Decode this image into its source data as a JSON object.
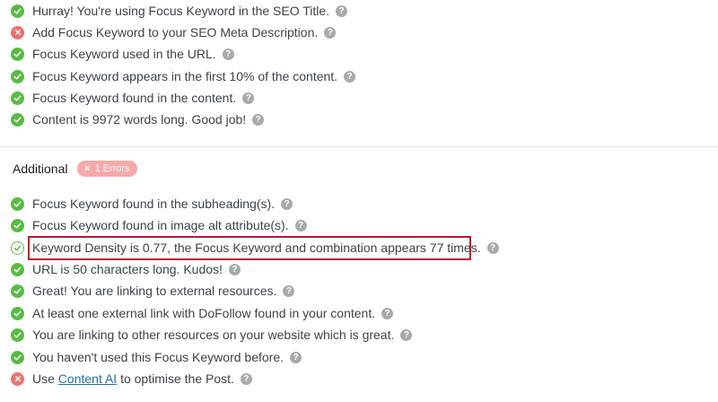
{
  "basic_checks": [
    {
      "status": "ok",
      "icon": "check-circle-icon",
      "text": "Hurray! You're using Focus Keyword in the SEO Title."
    },
    {
      "status": "fail",
      "icon": "error-circle-icon",
      "text": "Add Focus Keyword to your SEO Meta Description."
    },
    {
      "status": "ok",
      "icon": "check-circle-icon",
      "text": "Focus Keyword used in the URL."
    },
    {
      "status": "ok",
      "icon": "check-circle-icon",
      "text": "Focus Keyword appears in the first 10% of the content."
    },
    {
      "status": "ok",
      "icon": "check-circle-icon",
      "text": "Focus Keyword found in the content."
    },
    {
      "status": "ok",
      "icon": "check-circle-icon",
      "text": "Content is 9972 words long. Good job!"
    }
  ],
  "additional": {
    "title": "Additional",
    "error_badge": {
      "x": "×",
      "label": "1 Errors"
    },
    "checks": [
      {
        "status": "ok",
        "icon": "check-circle-icon",
        "text": "Focus Keyword found in the subheading(s)."
      },
      {
        "status": "ok",
        "icon": "check-circle-icon",
        "text": "Focus Keyword found in image alt attribute(s)."
      },
      {
        "status": "outline",
        "icon": "check-outline-icon",
        "text": "Keyword Density is 0.77, the Focus Keyword and combination appears 77 times.",
        "highlighted": true
      },
      {
        "status": "ok",
        "icon": "check-circle-icon",
        "text": "URL is 50 characters long. Kudos!"
      },
      {
        "status": "ok",
        "icon": "check-circle-icon",
        "text": "Great! You are linking to external resources."
      },
      {
        "status": "ok",
        "icon": "check-circle-icon",
        "text": "At least one external link with DoFollow found in your content."
      },
      {
        "status": "ok",
        "icon": "check-circle-icon",
        "text": "You are linking to other resources on your website which is great."
      },
      {
        "status": "ok",
        "icon": "check-circle-icon",
        "text": "You haven't used this Focus Keyword before."
      },
      {
        "status": "fail",
        "icon": "error-circle-icon",
        "text_before": "Use ",
        "link": "Content AI",
        "text_after": " to optimise the Post."
      }
    ]
  },
  "help_glyph": "?",
  "colors": {
    "ok": "#58bb43",
    "fail": "#ef6f6f",
    "help": "#a7aaad",
    "highlight": "#c8102e",
    "link": "#2271b1"
  }
}
